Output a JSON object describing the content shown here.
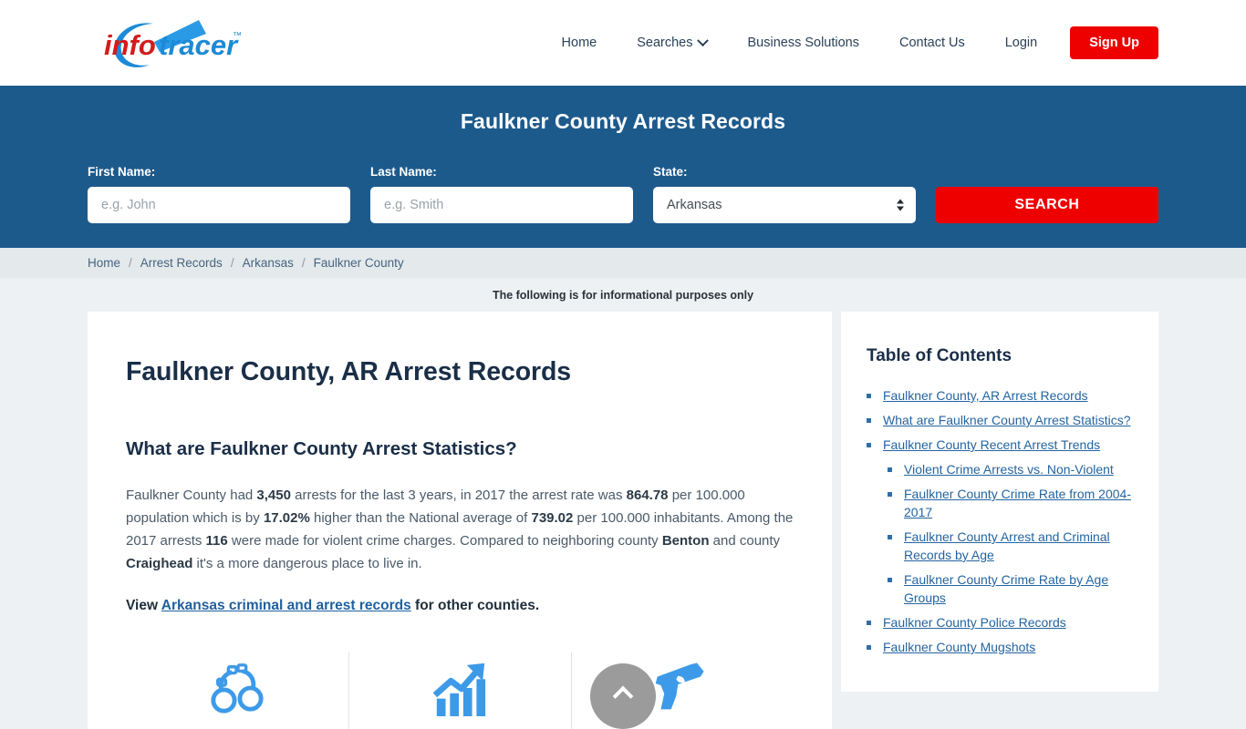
{
  "brand": {
    "logo_info": "info",
    "logo_tracer": "tracer",
    "logo_tm": "™",
    "colors": {
      "red": "#ee0000",
      "blue": "#1d5a8c",
      "link": "#2464a0",
      "logo_blue": "#1c8ad6"
    }
  },
  "nav": {
    "items": [
      {
        "label": "Home"
      },
      {
        "label": "Searches",
        "icon": "chevron-down-icon"
      },
      {
        "label": "Business Solutions"
      },
      {
        "label": "Contact Us"
      },
      {
        "label": "Login"
      }
    ],
    "signup_label": "Sign Up"
  },
  "banner": {
    "title": "Faulkner County Arrest Records",
    "first_name": {
      "label": "First Name:",
      "placeholder": "e.g. John",
      "value": ""
    },
    "last_name": {
      "label": "Last Name:",
      "placeholder": "e.g. Smith",
      "value": ""
    },
    "state": {
      "label": "State:",
      "selected": "Arkansas",
      "options": [
        "Arkansas"
      ]
    },
    "search_label": "SEARCH"
  },
  "breadcrumb": {
    "items": [
      "Home",
      "Arrest Records",
      "Arkansas",
      "Faulkner County"
    ],
    "separator": "/"
  },
  "notice": "The following is for informational purposes only",
  "article": {
    "h1": "Faulkner County, AR Arrest Records",
    "h2": "What are Faulkner County Arrest Statistics?",
    "paragraph": {
      "p1": "Faulkner County had ",
      "arrests": "3,450",
      "p2": " arrests for the last 3 years, in 2017 the arrest rate was ",
      "rate": "864.78",
      "p3": " per 100.000 population which is by ",
      "pct": "17.02%",
      "p4": " higher than the National average of ",
      "national": "739.02",
      "p5": " per 100.000 inhabitants. Among the 2017 arrests ",
      "violent": "116",
      "p6": " were made for violent crime charges. Compared to neighboring county ",
      "county1": "Benton",
      "p7": " and county ",
      "county2": "Craighead",
      "p8": " it's a more dangerous place to live in."
    },
    "view_prefix": "View ",
    "view_link": "Arkansas criminal and arrest records",
    "view_suffix": " for other counties.",
    "icons": [
      "handcuffs-icon",
      "growth-chart-icon",
      "handgun-icon"
    ]
  },
  "toc": {
    "title": "Table of Contents",
    "items": [
      {
        "label": "Faulkner County, AR Arrest Records",
        "level": 1
      },
      {
        "label": "What are Faulkner County Arrest Statistics?",
        "level": 1
      },
      {
        "label": "Faulkner County Recent Arrest Trends",
        "level": 1
      },
      {
        "label": "Violent Crime Arrests vs. Non-Violent",
        "level": 2
      },
      {
        "label": "Faulkner County Crime Rate from 2004-2017",
        "level": 2
      },
      {
        "label": "Faulkner County Arrest and Criminal Records by Age",
        "level": 2
      },
      {
        "label": "Faulkner County Crime Rate by Age Groups",
        "level": 2
      },
      {
        "label": "Faulkner County Police Records",
        "level": 1
      },
      {
        "label": "Faulkner County Mugshots",
        "level": 1
      }
    ]
  },
  "scroll_top": {
    "icon": "chevron-up-icon"
  }
}
